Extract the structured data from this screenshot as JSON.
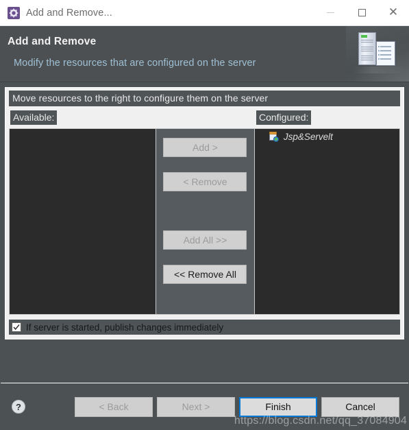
{
  "window": {
    "title": "Add and Remove...",
    "icon": "gear-icon",
    "controls": {
      "minimize": "minimize-icon",
      "maximize": "maximize-icon",
      "close": "close-icon"
    }
  },
  "header": {
    "title": "Add and Remove",
    "subtitle": "Modify the resources that are configured on the server",
    "art": "server-and-document-graphic"
  },
  "content": {
    "instruction": "Move resources to the right to configure them on the server",
    "available": {
      "label": "Available:",
      "items": []
    },
    "configured": {
      "label": "Configured:",
      "items": [
        {
          "name": "Jsp&Servelt",
          "icon": "project-module-icon"
        }
      ]
    },
    "transfer_buttons": [
      {
        "label": "Add >",
        "enabled": false
      },
      {
        "label": "< Remove",
        "enabled": false
      },
      {
        "label": "Add All >>",
        "enabled": false
      },
      {
        "label": "<< Remove All",
        "enabled": true
      }
    ],
    "publish_checkbox": {
      "label": "If server is started, publish changes immediately",
      "checked": true
    }
  },
  "footer": {
    "help": "?",
    "buttons": [
      {
        "label": "< Back",
        "enabled": false,
        "default": false
      },
      {
        "label": "Next >",
        "enabled": false,
        "default": false
      },
      {
        "label": "Finish",
        "enabled": true,
        "default": true
      },
      {
        "label": "Cancel",
        "enabled": true,
        "default": false
      }
    ],
    "watermark": "https://blog.csdn.net/qq_37084904"
  },
  "colors": {
    "header_bg": "#4c5052",
    "dialog_bg": "#4c5154",
    "panel_bg": "#f0f0f0",
    "list_bg": "#2b2b2b",
    "accent_focus": "#0078d7",
    "subtitle": "#9fc0d4",
    "label_bg": "#4f5457"
  }
}
